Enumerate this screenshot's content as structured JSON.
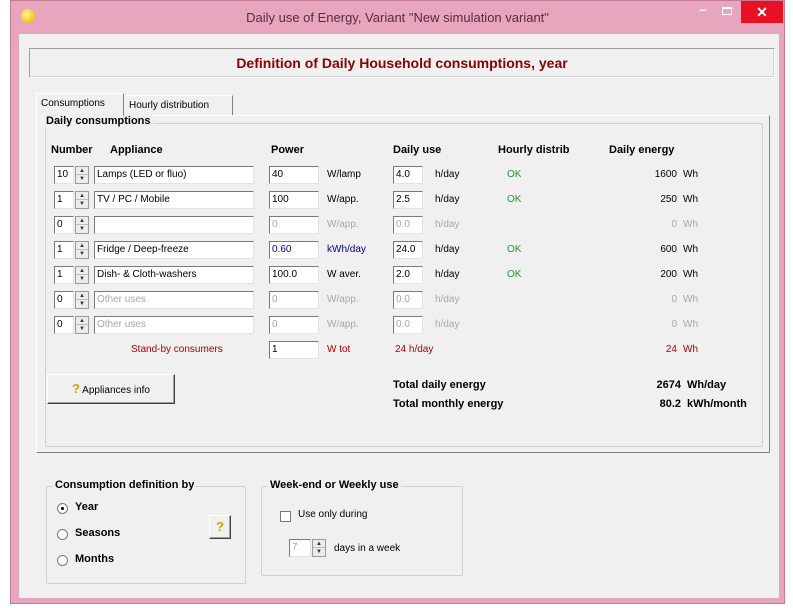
{
  "window": {
    "title": "Daily use of Energy, Variant  \"New simulation variant\""
  },
  "header": {
    "title": "Definition of Daily Household consumptions, year"
  },
  "tabs": [
    {
      "label": "Consumptions"
    },
    {
      "label": "Hourly distribution"
    }
  ],
  "daily": {
    "group_title": "Daily consumptions",
    "headers": {
      "number": "Number",
      "appliance": "Appliance",
      "power": "Power",
      "daily_use": "Daily use",
      "hourly": "Hourly distrib",
      "energy": "Daily energy"
    },
    "rows": [
      {
        "number": "10",
        "appliance": "Lamps (LED or fluo)",
        "power": "40",
        "power_unit": "W/lamp",
        "daily_use": "4.0",
        "use_unit": "h/day",
        "hourly": "OK",
        "energy": "1600",
        "energy_unit": "Wh"
      },
      {
        "number": "1",
        "appliance": "TV / PC / Mobile",
        "power": "100",
        "power_unit": "W/app.",
        "daily_use": "2.5",
        "use_unit": "h/day",
        "hourly": "OK",
        "energy": "250",
        "energy_unit": "Wh"
      },
      {
        "number": "0",
        "appliance": "",
        "power": "0",
        "power_unit": "W/app.",
        "daily_use": "0.0",
        "use_unit": "h/day",
        "hourly": "",
        "energy": "0",
        "energy_unit": "Wh"
      },
      {
        "number": "1",
        "appliance": "Fridge / Deep-freeze",
        "power": "0.60",
        "power_unit": "kWh/day",
        "daily_use": "24.0",
        "use_unit": "h/day",
        "hourly": "OK",
        "energy": "600",
        "energy_unit": "Wh"
      },
      {
        "number": "1",
        "appliance": "Dish- & Cloth-washers",
        "power": "100.0",
        "power_unit": "W aver.",
        "daily_use": "2.0",
        "use_unit": "h/day",
        "hourly": "OK",
        "energy": "200",
        "energy_unit": "Wh"
      },
      {
        "number": "0",
        "appliance": "Other uses",
        "power": "0",
        "power_unit": "W/app.",
        "daily_use": "0.0",
        "use_unit": "h/day",
        "hourly": "",
        "energy": "0",
        "energy_unit": "Wh"
      },
      {
        "number": "0",
        "appliance": "Other uses",
        "power": "0",
        "power_unit": "W/app.",
        "daily_use": "0.0",
        "use_unit": "h/day",
        "hourly": "",
        "energy": "0",
        "energy_unit": "Wh"
      }
    ],
    "standby": {
      "label": "Stand-by consumers",
      "power": "1",
      "unit": "W tot",
      "use": "24 h/day",
      "energy": "24",
      "energy_unit": "Wh"
    },
    "info_button": "Appliances info",
    "totals": {
      "daily_label": "Total daily energy",
      "daily_value": "2674",
      "daily_unit": "Wh/day",
      "monthly_label": "Total monthly energy",
      "monthly_value": "80.2",
      "monthly_unit": "kWh/month"
    }
  },
  "definition": {
    "title": "Consumption definition by",
    "options": [
      {
        "label": "Year",
        "selected": true
      },
      {
        "label": "Seasons",
        "selected": false
      },
      {
        "label": "Months",
        "selected": false
      }
    ]
  },
  "weekly": {
    "title": "Week-end or Weekly use",
    "checkbox_label": "Use only during",
    "days_value": "7",
    "days_label": "days in a week"
  },
  "colors": {
    "accent_red": "#8b0000",
    "ok_green": "#1a9a2a",
    "title_bar": "#e7a6bd",
    "close": "#e81123"
  }
}
